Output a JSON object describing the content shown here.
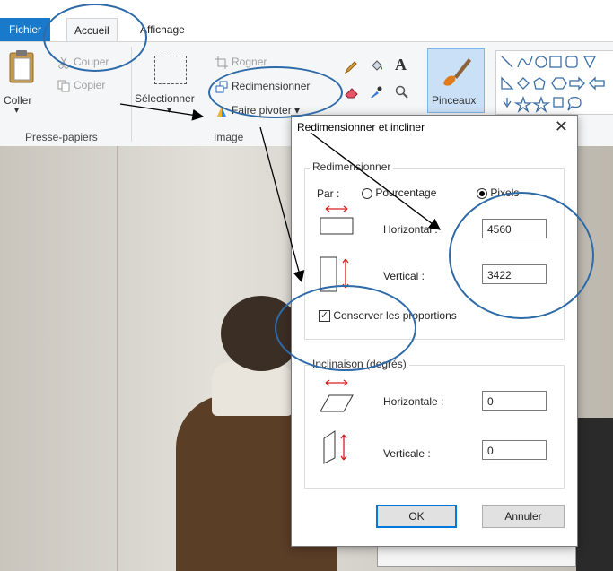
{
  "ribbon": {
    "tabs": {
      "file": "Fichier",
      "home": "Accueil",
      "view": "Affichage"
    },
    "clipboard": {
      "paste": "Coller",
      "cut": "Couper",
      "copy": "Copier",
      "group_label": "Presse-papiers"
    },
    "image": {
      "select": "Sélectionner",
      "crop": "Rogner",
      "resize": "Redimensionner",
      "rotate": "Faire pivoter ▾",
      "group_label": "Image"
    },
    "brushes": {
      "label": "Pinceaux"
    }
  },
  "dialog": {
    "title": "Redimensionner et incliner",
    "close": "✕",
    "resize": {
      "legend": "Redimensionner",
      "by_label": "Par :",
      "percent_label": "Pourcentage",
      "pixels_label": "Pixels",
      "selected_unit": "Pixels",
      "horizontal_label": "Horizontal :",
      "horizontal_value": "4560",
      "vertical_label": "Vertical :",
      "vertical_value": "3422",
      "keep_ratio_label": "Conserver les proportions",
      "keep_ratio_checked": true
    },
    "skew": {
      "legend": "Inclinaison (degrés)",
      "horizontal_label": "Horizontale :",
      "horizontal_value": "0",
      "vertical_label": "Verticale :",
      "vertical_value": "0"
    },
    "ok": "OK",
    "cancel": "Annuler"
  },
  "colors": {
    "file_tab": "#1979ca",
    "ring": "#2e6aa8",
    "focus": "#0078d7",
    "resize_icon_red": "#d62020"
  }
}
